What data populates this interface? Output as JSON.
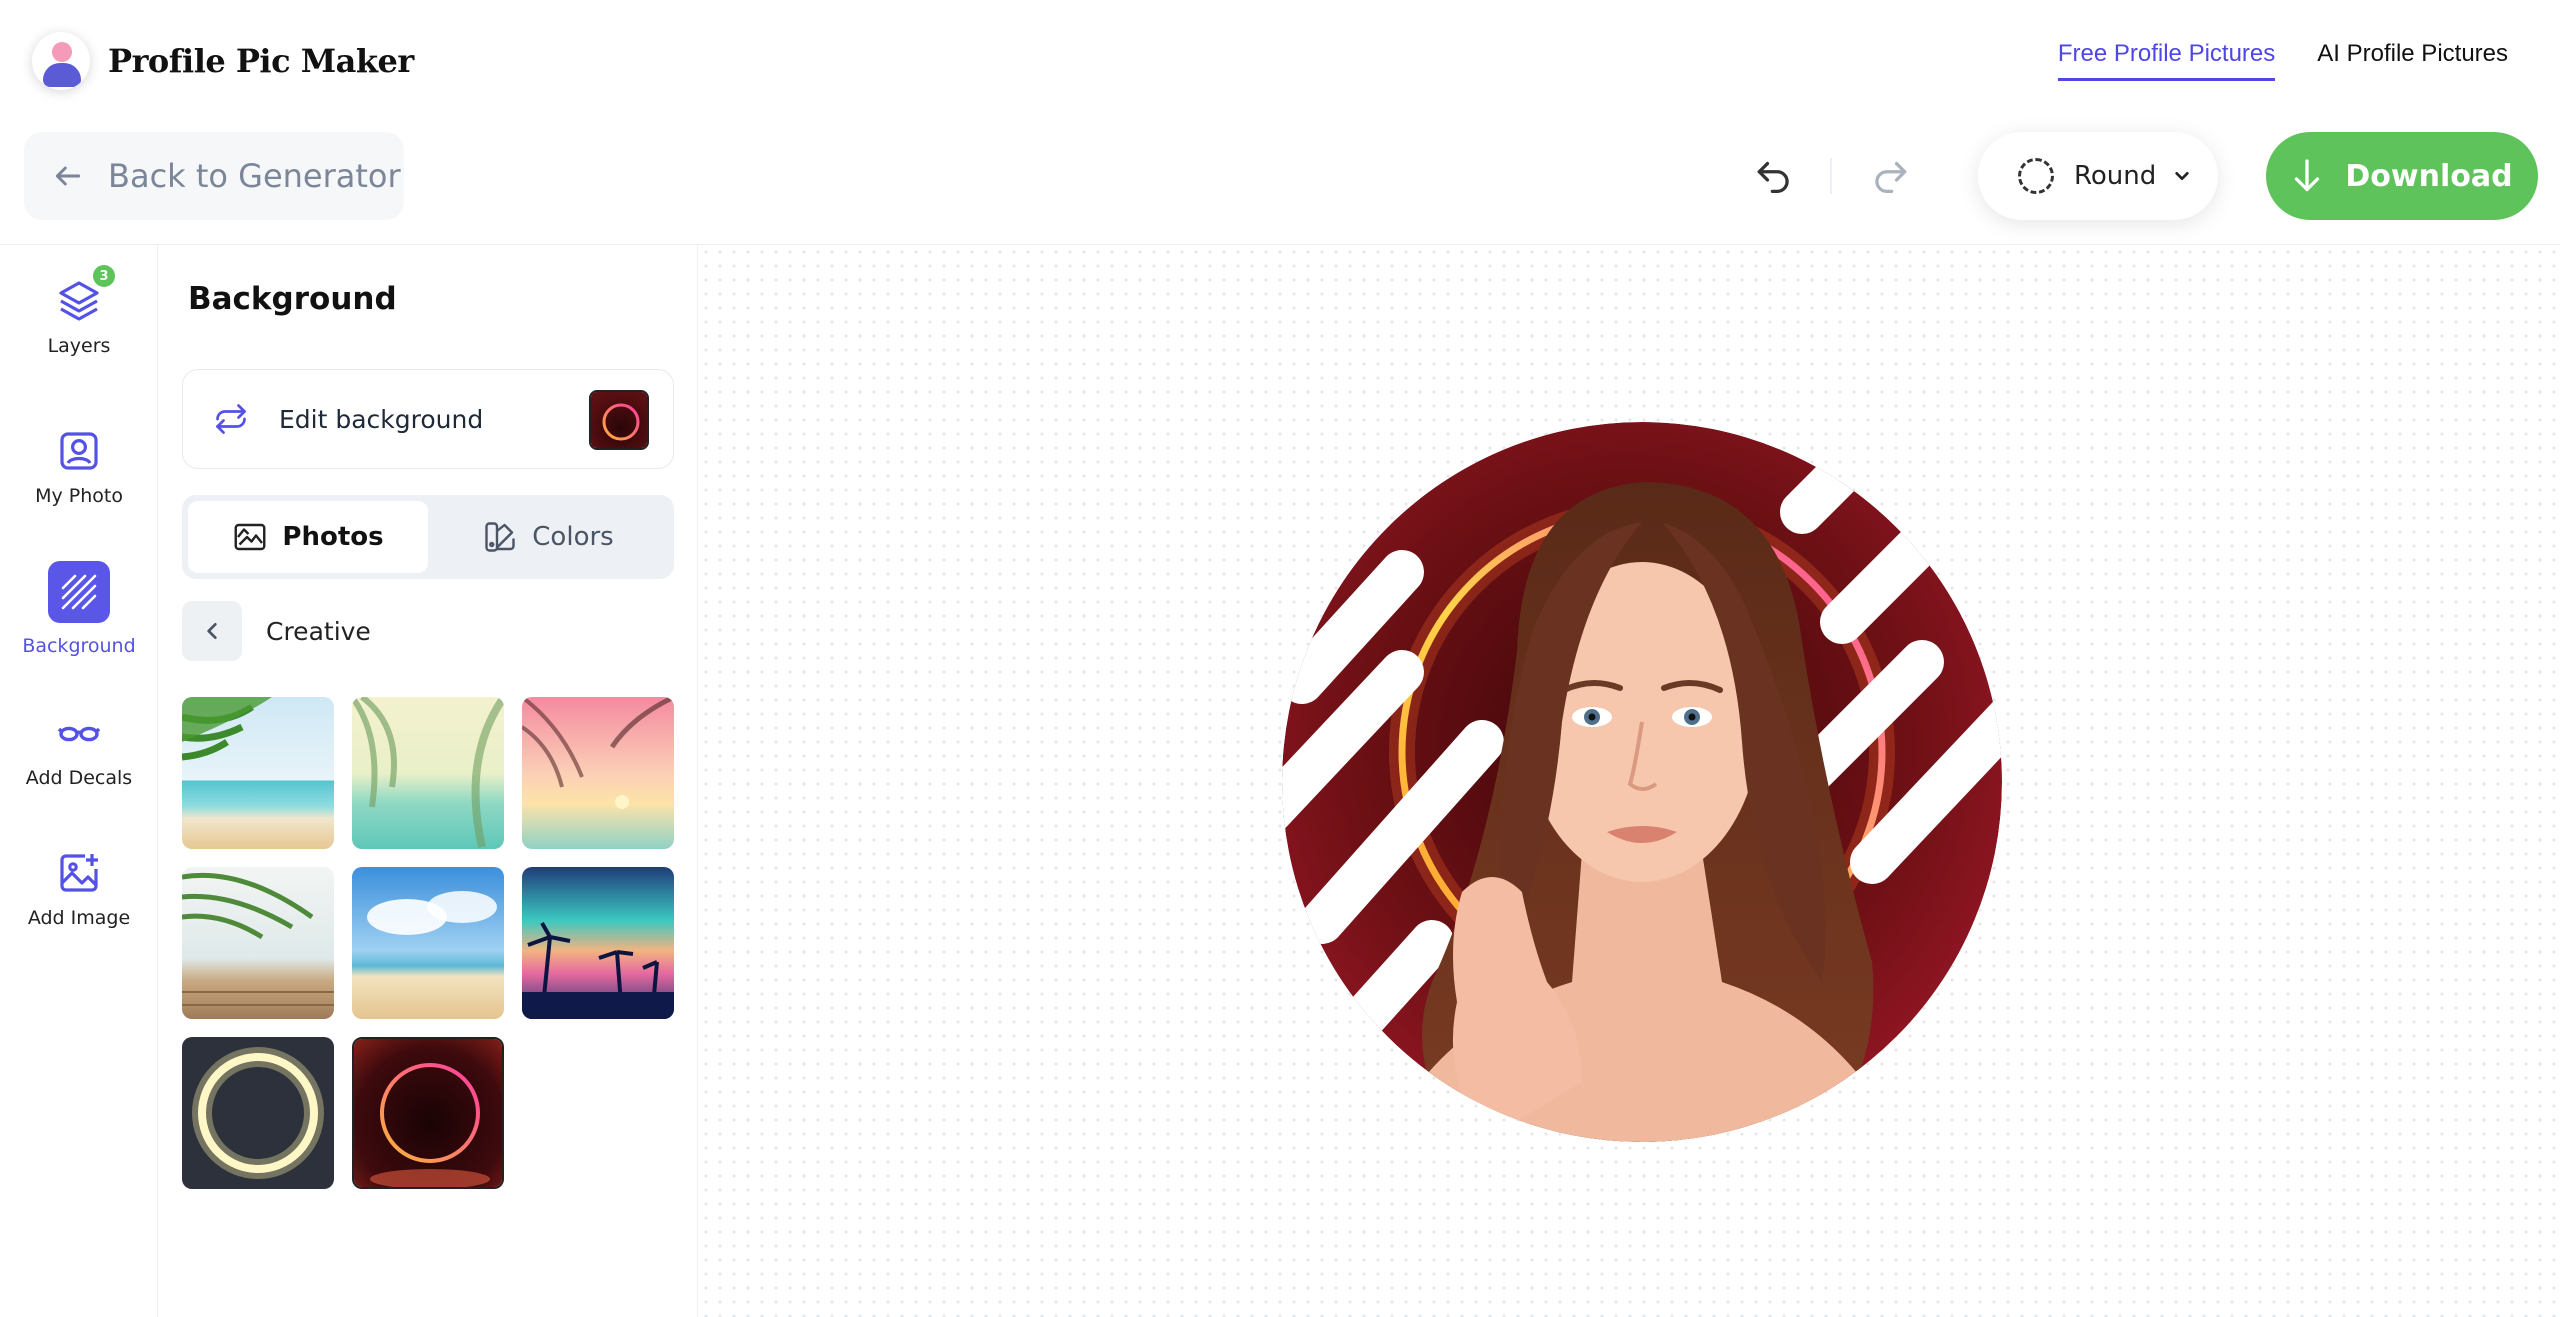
{
  "app": {
    "title": "Profile Pic Maker"
  },
  "topnav": {
    "items": [
      {
        "label": "Free Profile Pictures",
        "active": true
      },
      {
        "label": "AI Profile Pictures",
        "active": false
      }
    ]
  },
  "toolbar": {
    "back_label": "Back to Generator",
    "shape_label": "Round",
    "download_label": "Download",
    "accent_color": "#4f46e5",
    "download_color": "#5fc35c"
  },
  "rail": {
    "items": [
      {
        "label": "Layers",
        "icon": "layers-icon",
        "badge": "3"
      },
      {
        "label": "My Photo",
        "icon": "portrait-icon"
      },
      {
        "label": "Background",
        "icon": "background-icon",
        "active": true
      },
      {
        "label": "Add Decals",
        "icon": "glasses-icon"
      },
      {
        "label": "Add Image",
        "icon": "add-image-icon"
      }
    ]
  },
  "panel": {
    "title": "Background",
    "edit_label": "Edit background",
    "tabs": [
      {
        "label": "Photos",
        "active": true
      },
      {
        "label": "Colors",
        "active": false
      }
    ],
    "category": "Creative",
    "thumbnails": [
      "beach-palm",
      "tropical-haze",
      "sunset-palms",
      "palm-deck",
      "sand-sky",
      "neon-palms",
      "yellow-ring",
      "red-neon-ring"
    ]
  }
}
